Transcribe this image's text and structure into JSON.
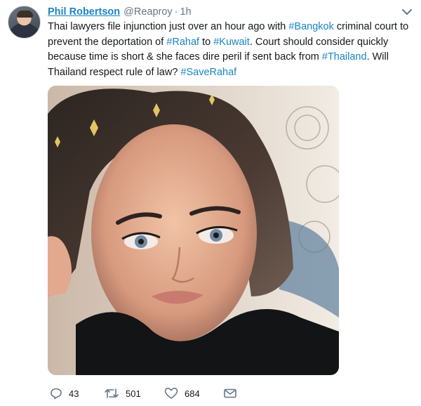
{
  "tweet": {
    "author_name": "Phil Robertson",
    "handle": "@Reaproy",
    "separator": "·",
    "time": "1h",
    "text_segments": [
      {
        "text": "Thai lawyers file injunction just over an hour ago with ",
        "hashtag": false
      },
      {
        "text": "#Bangkok",
        "hashtag": true
      },
      {
        "text": " criminal court to prevent the deportation of ",
        "hashtag": false
      },
      {
        "text": "#Rahaf",
        "hashtag": true
      },
      {
        "text": " to ",
        "hashtag": false
      },
      {
        "text": "#Kuwait",
        "hashtag": true
      },
      {
        "text": ". Court should consider quickly because time is short & she faces dire peril if sent back from ",
        "hashtag": false
      },
      {
        "text": "#Thailand",
        "hashtag": true
      },
      {
        "text": ".  Will Thailand respect rule of law? ",
        "hashtag": false
      },
      {
        "text": "#SaveRahaf",
        "hashtag": true
      }
    ],
    "actions": {
      "replies": "43",
      "retweets": "501",
      "likes": "684"
    }
  },
  "icons": {
    "caret": "chevron-down-icon",
    "reply": "reply-bubble-icon",
    "retweet": "retweet-arrows-icon",
    "like": "heart-icon",
    "dm": "envelope-icon"
  },
  "colors": {
    "link": "#1b84c4",
    "text": "#14171a",
    "muted": "#657786"
  }
}
